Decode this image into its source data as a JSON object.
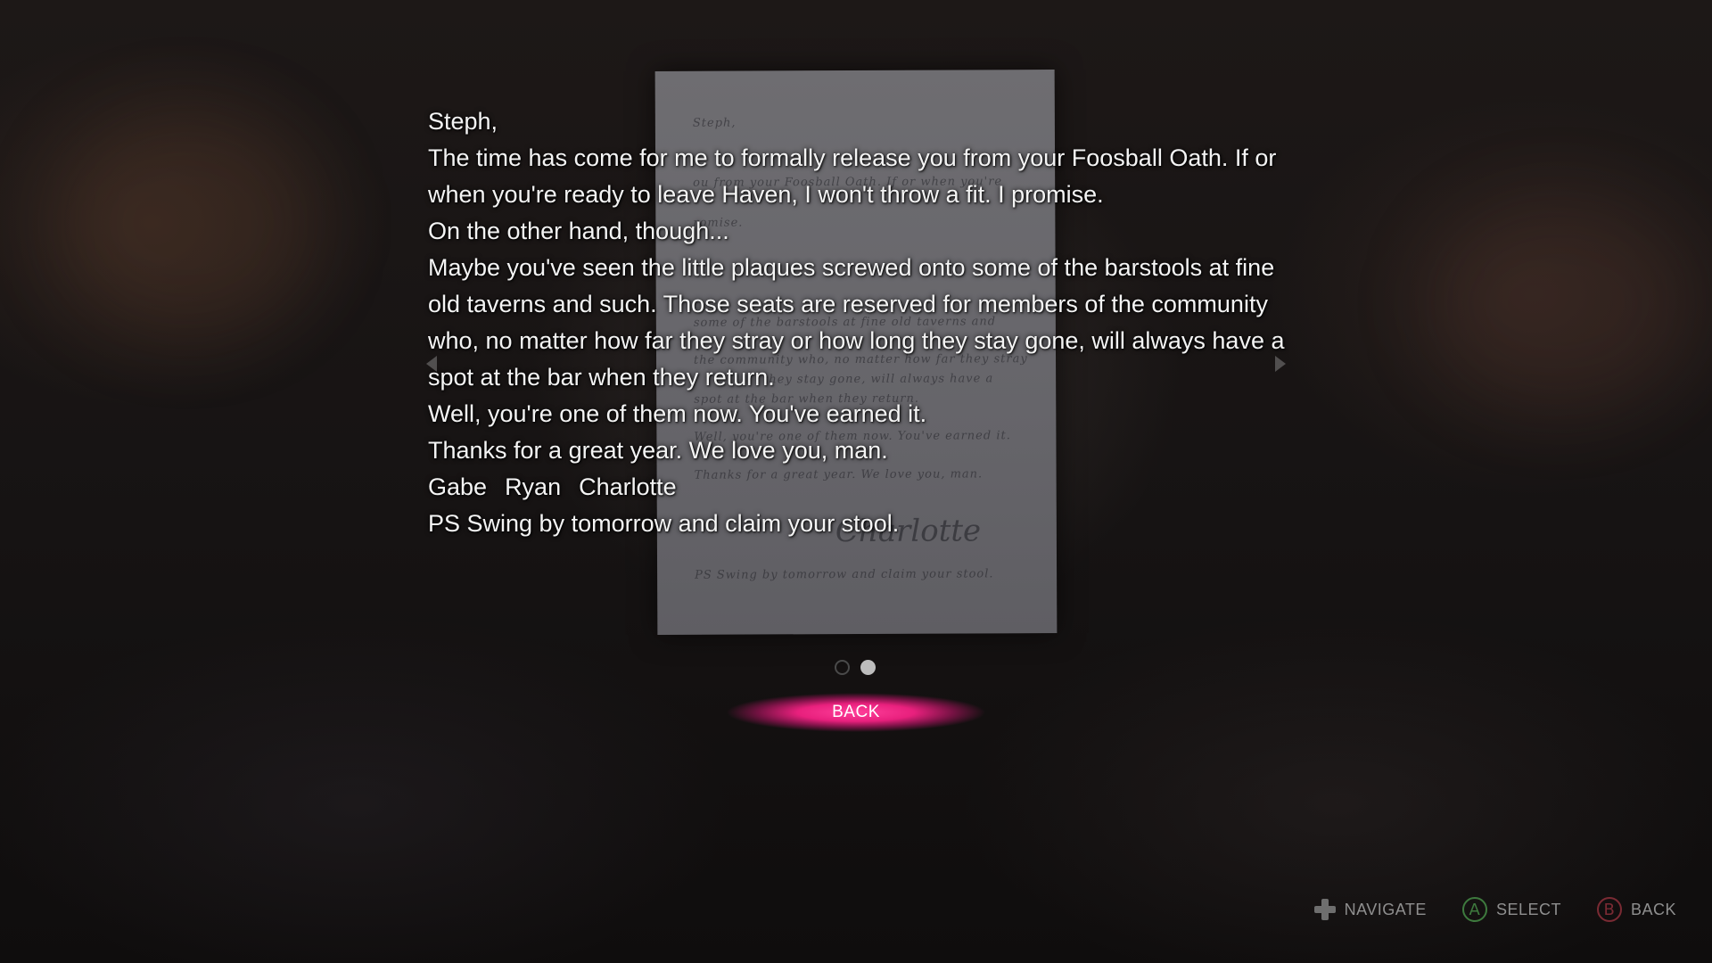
{
  "letter": {
    "overlay_lines": [
      "Steph,",
      "The time has come for me to formally release you from your Foosball Oath. If or when you're ready to leave Haven, I won't throw a fit. I promise.",
      "On the other hand, though...",
      "Maybe you've seen the little plaques screwed onto some of the barstools at fine old taverns and such. Those seats are reserved for members of the community who, no matter how far they stray or how long they stay gone, will always have a spot at the bar when they return.",
      "Well, you're one of them now. You've earned it.",
      "Thanks for a great year. We love you, man."
    ],
    "signatures": [
      "Gabe",
      "Ryan",
      "Charlotte"
    ],
    "postscript": "PS Swing by tomorrow and claim your stool.",
    "handwritten": {
      "greeting": "Steph,",
      "line1": "ou from your Foosball Oath. If or when you're",
      "line2": "romise.",
      "line3": "some of the barstools at fine old taverns and",
      "line4": "the community who, no matter how far they stray",
      "line5": "they stay gone, will always have a",
      "line6": "spot at the bar when they return.",
      "line7": "Well, you're one of them now. You've earned it.",
      "line8": "Thanks for a great year. We love you, man.",
      "signature": "Charlotte",
      "ps": "PS Swing by tomorrow and claim your stool."
    }
  },
  "pager": {
    "total_pages": 2,
    "current_page": 2
  },
  "back_button": {
    "label": "BACK"
  },
  "controller_hints": {
    "navigate": "NAVIGATE",
    "a_glyph": "A",
    "select": "SELECT",
    "b_glyph": "B",
    "back": "BACK"
  },
  "colors": {
    "accent": "#e8207d",
    "hint_a": "#3e7a3e",
    "hint_b": "#7a2a33"
  },
  "icons": [
    "dpad-icon",
    "a-button-icon",
    "b-button-icon",
    "prev-page-arrow-icon",
    "next-page-arrow-icon"
  ]
}
